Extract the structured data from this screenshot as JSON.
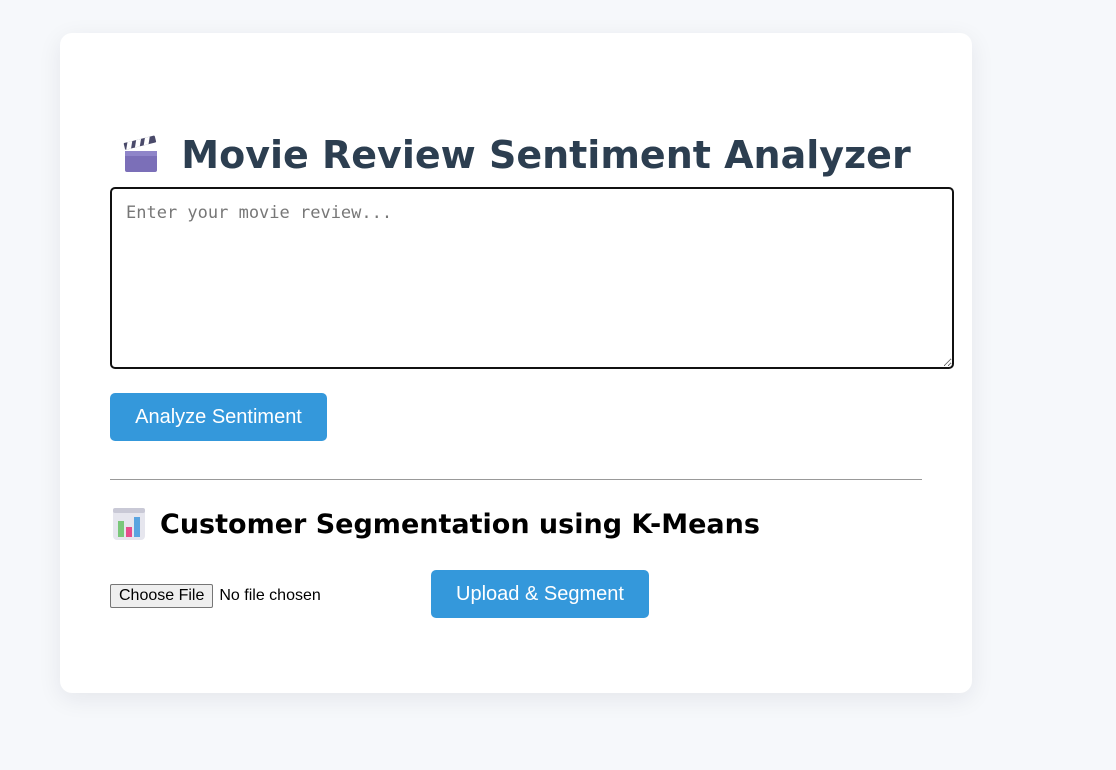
{
  "header": {
    "title": "Movie Review Sentiment Analyzer",
    "icon": "clapperboard-icon"
  },
  "review": {
    "placeholder": "Enter your movie review...",
    "value": ""
  },
  "actions": {
    "analyze_label": "Analyze Sentiment",
    "upload_label": "Upload & Segment"
  },
  "segmentation": {
    "title": "Customer Segmentation using K-Means",
    "icon": "bar-chart-icon",
    "choose_file_label": "Choose File",
    "file_status": "No file chosen"
  },
  "colors": {
    "accent": "#3498db",
    "title": "#2c3e50",
    "background": "#f6f8fb"
  }
}
